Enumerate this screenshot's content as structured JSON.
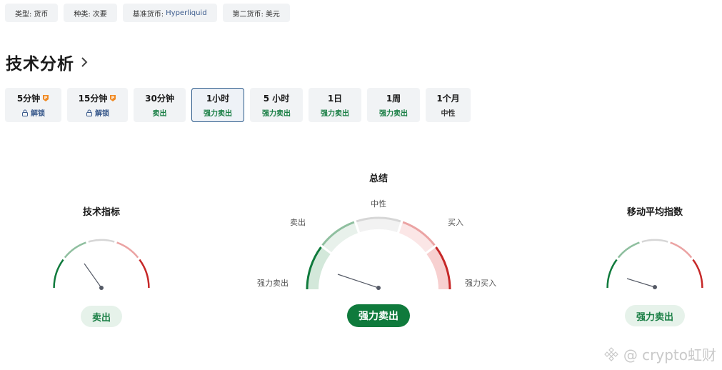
{
  "tags": [
    {
      "label": "类型:",
      "value": "货币"
    },
    {
      "label": "种类:",
      "value": "次要"
    },
    {
      "label": "基准货币:",
      "value": "Hyperliquid"
    },
    {
      "label": "第二货币:",
      "value": "美元"
    }
  ],
  "section_title": "技术分析",
  "timeframes": [
    {
      "label": "5分钟",
      "status": "解锁",
      "locked": true
    },
    {
      "label": "15分钟",
      "status": "解锁",
      "locked": true
    },
    {
      "label": "30分钟",
      "status": "卖出",
      "locked": false
    },
    {
      "label": "1小时",
      "status": "强力卖出",
      "locked": false,
      "active": true
    },
    {
      "label": "5 小时",
      "status": "强力卖出",
      "locked": false
    },
    {
      "label": "1日",
      "status": "强力卖出",
      "locked": false
    },
    {
      "label": "1周",
      "status": "强力卖出",
      "locked": false
    },
    {
      "label": "1个月",
      "status": "中性",
      "locked": false
    }
  ],
  "summary": {
    "title": "总结",
    "labels": {
      "neutral": "中性",
      "sell": "卖出",
      "buy": "买入",
      "strong_sell": "强力卖出",
      "strong_buy": "强力买入"
    },
    "result": "强力卖出"
  },
  "indicators": {
    "title": "技术指标",
    "result": "卖出"
  },
  "moving_averages": {
    "title": "移动平均指数",
    "result": "强力卖出"
  },
  "watermark": "@ crypto虹财",
  "colors": {
    "strong_sell": "#0f7a3c",
    "sell": "#1a7f45",
    "strong_buy": "#c62828",
    "accent": "#2b5a8a"
  }
}
